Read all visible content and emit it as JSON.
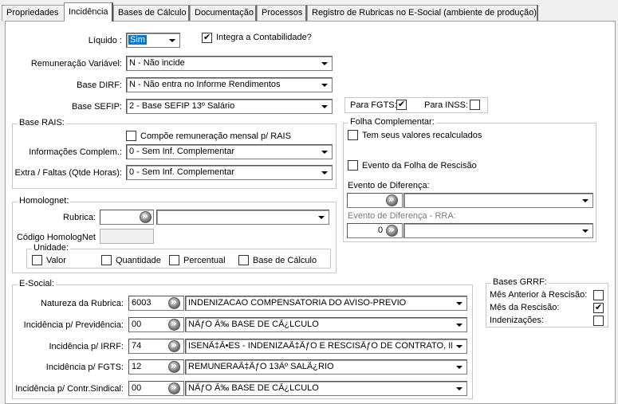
{
  "tabs": [
    {
      "label": "Propriedades"
    },
    {
      "label": "Incidência"
    },
    {
      "label": "Bases de Cálculo"
    },
    {
      "label": "Documentação"
    },
    {
      "label": "Processos"
    },
    {
      "label": "Registro de Rubricas no E-Social (ambiente de produção)"
    }
  ],
  "top": {
    "liquido_label": "Líquido :",
    "liquido_value": "Sim",
    "integra_label": "Integra a Contabilidade?",
    "integra_checked": true,
    "rem_var_label": "Remuneração Variável:",
    "rem_var_value": "N - Não incide",
    "dirf_label": "Base DIRF:",
    "dirf_value": "N - Não entra no Informe Rendimentos",
    "sefip_label": "Base SEFIP:",
    "sefip_value": "2 - Base SEFIP 13º Salário",
    "fgts_label": "Para FGTS:",
    "fgts_checked": true,
    "inss_label": "Para INSS:",
    "inss_checked": false
  },
  "rais": {
    "title": "Base RAIS:",
    "compoe_label": "Compõe remuneração mensal p/ RAIS",
    "info_label": "Informações Complem.:",
    "info_value": "0 - Sem Inf. Complementar",
    "extra_label": "Extra / Faltas (Qtde Horas):",
    "extra_value": "0 - Sem Inf. Complementar"
  },
  "folha": {
    "title": "Folha Complementar:",
    "recalc_label": "Tem seus valores recalculados",
    "rescisao_label": "Evento da Folha de Rescisão",
    "diferenca_label": "Evento de Diferença:",
    "diferenca_rra_label": "Evento de Diferença - RRA:",
    "diferenca_rra_code": "0"
  },
  "homolognet": {
    "title": "Homolognet:",
    "rubrica_label": "Rubrica:",
    "codigo_label": "Código HomologNet",
    "unidade_title": "Unidade:",
    "unidade_options": [
      "Valor",
      "Quantidade",
      "Percentual",
      "Base de Cálculo"
    ]
  },
  "esocial": {
    "title": "E-Social:",
    "rows": [
      {
        "label": "Natureza da Rubrica:",
        "code": "6003",
        "desc": "INDENIZACAO COMPENSATORIA DO AVISO-PREVIO"
      },
      {
        "label": "Incidência p/ Previdência:",
        "code": "00",
        "desc": "NÃƒO Ã‰ BASE DE CÃ¿LCULO"
      },
      {
        "label": "Incidência p/ IRRF:",
        "code": "74",
        "desc": "ISENÃ‡Ã•ES - INDENIZAÃ‡ÃƒO E RESCISÃƒO DE CONTRATO, INCLU"
      },
      {
        "label": "Incidência p/ FGTS:",
        "code": "12",
        "desc": "REMUNERAÃ‡ÃƒO 13Âº SALÃ¿RIO"
      },
      {
        "label": "Incidência p/ Contr.Sindical:",
        "code": "00",
        "desc": "NÃƒO Ã‰ BASE DE CÃ¿LCULO"
      }
    ]
  },
  "grrf": {
    "title": "Bases GRRF:",
    "items": [
      {
        "label": "Mês Anterior à Rescisão:",
        "checked": false
      },
      {
        "label": "Mês da Rescisão:",
        "checked": true
      },
      {
        "label": "Indenizações:",
        "checked": false
      }
    ]
  }
}
